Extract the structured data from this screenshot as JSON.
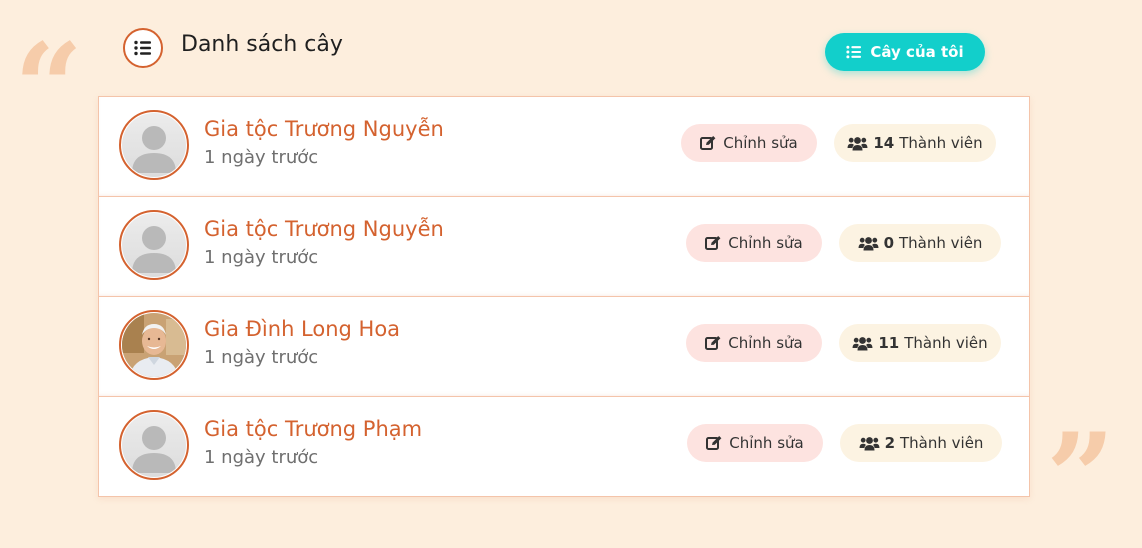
{
  "header": {
    "title": "Danh sách cây",
    "my_trees_button": "Cây của tôi"
  },
  "decor": {
    "open_quote": "“",
    "close_quote": "”"
  },
  "colors": {
    "accent": "#d4622f",
    "teal": "#12cfcb",
    "background": "#fdeedd"
  },
  "trees": [
    {
      "name": "Gia tộc Trương Nguyễn",
      "time": "1 ngày trước",
      "edit_label": "Chỉnh sửa",
      "member_count": "14",
      "member_label": "Thành viên",
      "avatar": "default-avatar"
    },
    {
      "name": "Gia tộc Trương Nguyễn",
      "time": "1 ngày trước",
      "edit_label": "Chỉnh sửa",
      "member_count": "0",
      "member_label": "Thành viên",
      "avatar": "default-avatar"
    },
    {
      "name": "Gia Đình Long Hoa",
      "time": "1 ngày trước",
      "edit_label": "Chỉnh sửa",
      "member_count": "11",
      "member_label": "Thành viên",
      "avatar": "photo-avatar"
    },
    {
      "name": "Gia tộc Trương Phạm",
      "time": "1 ngày trước",
      "edit_label": "Chỉnh sửa",
      "member_count": "2",
      "member_label": "Thành viên",
      "avatar": "default-avatar"
    }
  ]
}
